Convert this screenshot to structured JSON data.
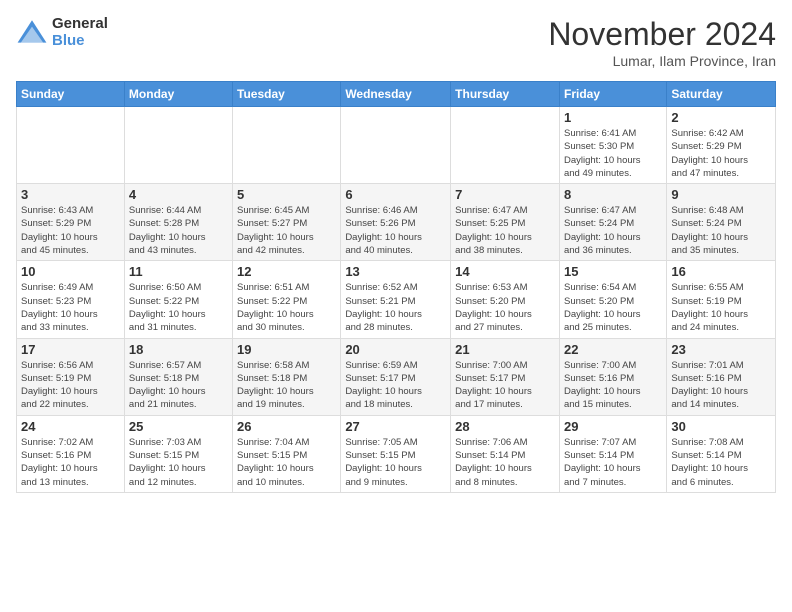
{
  "header": {
    "logo_general": "General",
    "logo_blue": "Blue",
    "month_title": "November 2024",
    "subtitle": "Lumar, Ilam Province, Iran"
  },
  "weekdays": [
    "Sunday",
    "Monday",
    "Tuesday",
    "Wednesday",
    "Thursday",
    "Friday",
    "Saturday"
  ],
  "weeks": [
    [
      {
        "day": "",
        "info": ""
      },
      {
        "day": "",
        "info": ""
      },
      {
        "day": "",
        "info": ""
      },
      {
        "day": "",
        "info": ""
      },
      {
        "day": "",
        "info": ""
      },
      {
        "day": "1",
        "info": "Sunrise: 6:41 AM\nSunset: 5:30 PM\nDaylight: 10 hours\nand 49 minutes."
      },
      {
        "day": "2",
        "info": "Sunrise: 6:42 AM\nSunset: 5:29 PM\nDaylight: 10 hours\nand 47 minutes."
      }
    ],
    [
      {
        "day": "3",
        "info": "Sunrise: 6:43 AM\nSunset: 5:29 PM\nDaylight: 10 hours\nand 45 minutes."
      },
      {
        "day": "4",
        "info": "Sunrise: 6:44 AM\nSunset: 5:28 PM\nDaylight: 10 hours\nand 43 minutes."
      },
      {
        "day": "5",
        "info": "Sunrise: 6:45 AM\nSunset: 5:27 PM\nDaylight: 10 hours\nand 42 minutes."
      },
      {
        "day": "6",
        "info": "Sunrise: 6:46 AM\nSunset: 5:26 PM\nDaylight: 10 hours\nand 40 minutes."
      },
      {
        "day": "7",
        "info": "Sunrise: 6:47 AM\nSunset: 5:25 PM\nDaylight: 10 hours\nand 38 minutes."
      },
      {
        "day": "8",
        "info": "Sunrise: 6:47 AM\nSunset: 5:24 PM\nDaylight: 10 hours\nand 36 minutes."
      },
      {
        "day": "9",
        "info": "Sunrise: 6:48 AM\nSunset: 5:24 PM\nDaylight: 10 hours\nand 35 minutes."
      }
    ],
    [
      {
        "day": "10",
        "info": "Sunrise: 6:49 AM\nSunset: 5:23 PM\nDaylight: 10 hours\nand 33 minutes."
      },
      {
        "day": "11",
        "info": "Sunrise: 6:50 AM\nSunset: 5:22 PM\nDaylight: 10 hours\nand 31 minutes."
      },
      {
        "day": "12",
        "info": "Sunrise: 6:51 AM\nSunset: 5:22 PM\nDaylight: 10 hours\nand 30 minutes."
      },
      {
        "day": "13",
        "info": "Sunrise: 6:52 AM\nSunset: 5:21 PM\nDaylight: 10 hours\nand 28 minutes."
      },
      {
        "day": "14",
        "info": "Sunrise: 6:53 AM\nSunset: 5:20 PM\nDaylight: 10 hours\nand 27 minutes."
      },
      {
        "day": "15",
        "info": "Sunrise: 6:54 AM\nSunset: 5:20 PM\nDaylight: 10 hours\nand 25 minutes."
      },
      {
        "day": "16",
        "info": "Sunrise: 6:55 AM\nSunset: 5:19 PM\nDaylight: 10 hours\nand 24 minutes."
      }
    ],
    [
      {
        "day": "17",
        "info": "Sunrise: 6:56 AM\nSunset: 5:19 PM\nDaylight: 10 hours\nand 22 minutes."
      },
      {
        "day": "18",
        "info": "Sunrise: 6:57 AM\nSunset: 5:18 PM\nDaylight: 10 hours\nand 21 minutes."
      },
      {
        "day": "19",
        "info": "Sunrise: 6:58 AM\nSunset: 5:18 PM\nDaylight: 10 hours\nand 19 minutes."
      },
      {
        "day": "20",
        "info": "Sunrise: 6:59 AM\nSunset: 5:17 PM\nDaylight: 10 hours\nand 18 minutes."
      },
      {
        "day": "21",
        "info": "Sunrise: 7:00 AM\nSunset: 5:17 PM\nDaylight: 10 hours\nand 17 minutes."
      },
      {
        "day": "22",
        "info": "Sunrise: 7:00 AM\nSunset: 5:16 PM\nDaylight: 10 hours\nand 15 minutes."
      },
      {
        "day": "23",
        "info": "Sunrise: 7:01 AM\nSunset: 5:16 PM\nDaylight: 10 hours\nand 14 minutes."
      }
    ],
    [
      {
        "day": "24",
        "info": "Sunrise: 7:02 AM\nSunset: 5:16 PM\nDaylight: 10 hours\nand 13 minutes."
      },
      {
        "day": "25",
        "info": "Sunrise: 7:03 AM\nSunset: 5:15 PM\nDaylight: 10 hours\nand 12 minutes."
      },
      {
        "day": "26",
        "info": "Sunrise: 7:04 AM\nSunset: 5:15 PM\nDaylight: 10 hours\nand 10 minutes."
      },
      {
        "day": "27",
        "info": "Sunrise: 7:05 AM\nSunset: 5:15 PM\nDaylight: 10 hours\nand 9 minutes."
      },
      {
        "day": "28",
        "info": "Sunrise: 7:06 AM\nSunset: 5:14 PM\nDaylight: 10 hours\nand 8 minutes."
      },
      {
        "day": "29",
        "info": "Sunrise: 7:07 AM\nSunset: 5:14 PM\nDaylight: 10 hours\nand 7 minutes."
      },
      {
        "day": "30",
        "info": "Sunrise: 7:08 AM\nSunset: 5:14 PM\nDaylight: 10 hours\nand 6 minutes."
      }
    ]
  ],
  "row_classes": [
    "row-1",
    "row-2",
    "row-3",
    "row-4",
    "row-5"
  ]
}
